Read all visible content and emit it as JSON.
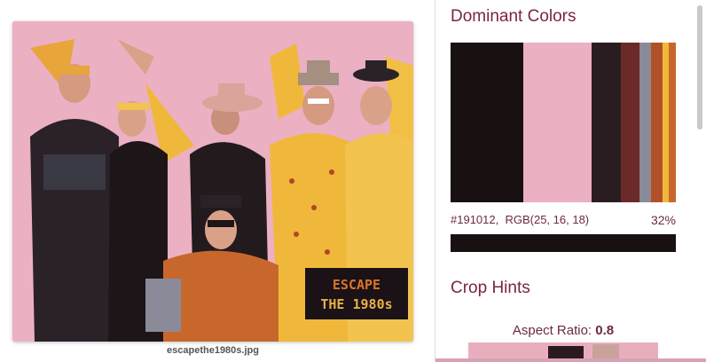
{
  "image": {
    "filename": "escapethe1980s.jpg",
    "sign_line1": "ESCAPE",
    "sign_line2": "THE 1980s",
    "colors": {
      "background": "#ebb0c2",
      "dark": "#191012",
      "yellow": "#f0b83a",
      "orange": "#c8672c",
      "sign_text1": "#d9742b",
      "sign_text2": "#e8b048"
    }
  },
  "dominant_colors": {
    "title": "Dominant Colors",
    "swatches": [
      {
        "color": "#191012",
        "weight": 32
      },
      {
        "color": "#ebb0c2",
        "weight": 30
      },
      {
        "color": "#2a1d22",
        "weight": 13
      },
      {
        "color": "#6b2a2a",
        "weight": 8
      },
      {
        "color": "#8a8a98",
        "weight": 5
      },
      {
        "color": "#b2502a",
        "weight": 5
      },
      {
        "color": "#f0b83a",
        "weight": 3
      },
      {
        "color": "#c8672c",
        "weight": 3
      }
    ],
    "selected": {
      "hex": "#191012,",
      "rgb": "RGB(25, 16, 18)",
      "percent": "32%",
      "color": "#191012"
    }
  },
  "crop_hints": {
    "title": "Crop Hints",
    "aspect_label": "Aspect Ratio:",
    "aspect_value": "0.8"
  }
}
